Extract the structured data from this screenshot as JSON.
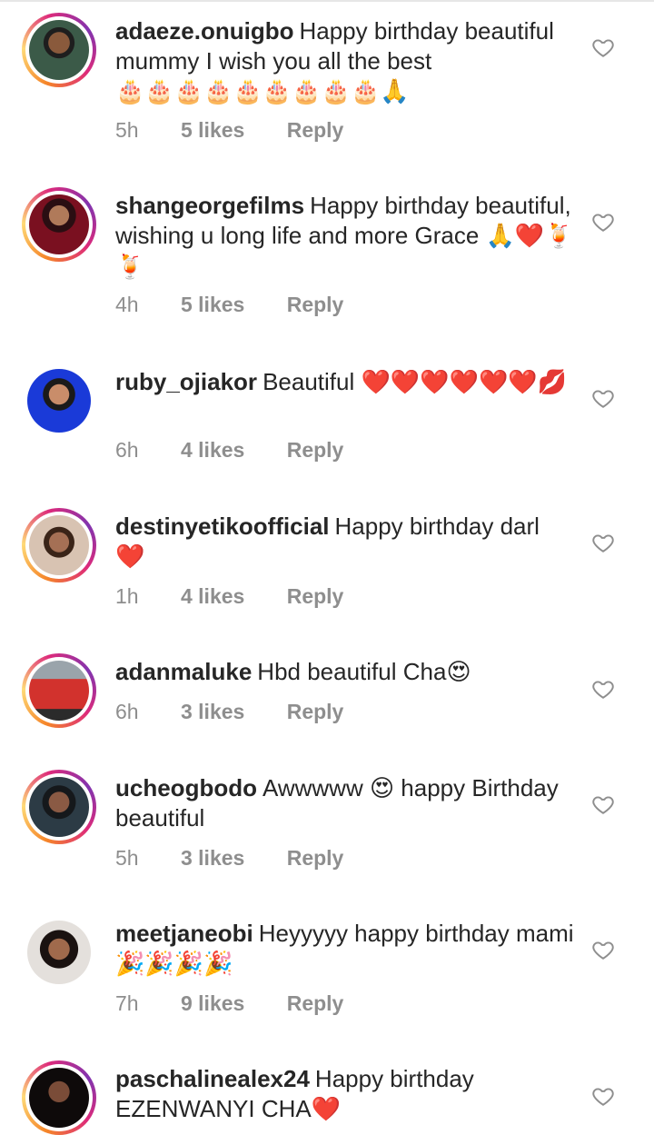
{
  "comments": [
    {
      "username": "adaeze.onuigbo",
      "text": "Happy birthday beautiful mummy I wish you all the best",
      "emojis": "🎂🎂🎂🎂🎂🎂🎂🎂🎂🙏",
      "time": "5h",
      "likes": "5 likes",
      "reply": "Reply",
      "story_ring": true,
      "avatar_color": "#2f4a3a"
    },
    {
      "username": "shangeorgefilms",
      "text": "Happy birthday beautiful, wishing u long life and more Grace",
      "emojis": "🙏❤️🍹🍹",
      "time": "4h",
      "likes": "5 likes",
      "reply": "Reply",
      "story_ring": true,
      "avatar_color": "#7a1020"
    },
    {
      "username": "ruby_ojiakor",
      "text": "Beautiful",
      "emojis": "❤️❤️❤️❤️❤️❤️💋",
      "time": "6h",
      "likes": "4 likes",
      "reply": "Reply",
      "story_ring": false,
      "avatar_color": "#1a3ad8"
    },
    {
      "username": "destinyetikoofficial",
      "text": "Happy birthday darl",
      "emojis": "❤️",
      "time": "1h",
      "likes": "4 likes",
      "reply": "Reply",
      "story_ring": true,
      "avatar_color": "#c9a68e"
    },
    {
      "username": "adanmaluke",
      "text": "Hbd beautiful Cha",
      "emojis": "😍",
      "time": "6h",
      "likes": "3 likes",
      "reply": "Reply",
      "story_ring": true,
      "avatar_color": "#d2322d"
    },
    {
      "username": "ucheogbodo",
      "text": "Awwwww 😍 happy Birthday beautiful",
      "emojis": "",
      "time": "5h",
      "likes": "3 likes",
      "reply": "Reply",
      "story_ring": true,
      "avatar_color": "#1c2a33"
    },
    {
      "username": "meetjaneobi",
      "text": "Heyyyyy happy birthday mami",
      "emojis": "🎉🎉🎉🎉",
      "time": "7h",
      "likes": "9 likes",
      "reply": "Reply",
      "story_ring": false,
      "avatar_color": "#2a1f1c"
    },
    {
      "username": "paschalinealex24",
      "text": "Happy birthday EZENWANYI CHA",
      "emojis": "❤️",
      "time": "",
      "likes": "",
      "reply": "",
      "story_ring": true,
      "avatar_color": "#1b1414"
    }
  ],
  "icons": {
    "like": "heart-outline-icon"
  },
  "colors": {
    "text": "#262626",
    "meta": "#8e8e8e",
    "heart_stroke": "#8e8e8e"
  }
}
